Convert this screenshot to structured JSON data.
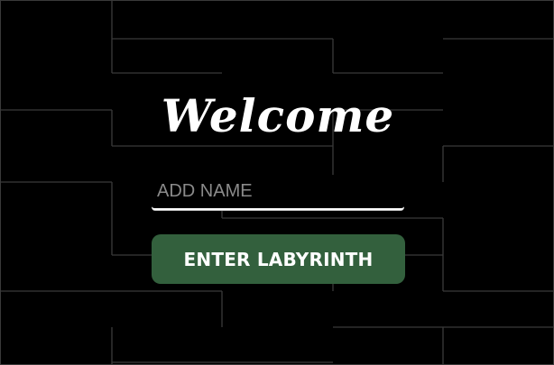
{
  "welcome": {
    "title": "Welcome"
  },
  "name_input": {
    "placeholder": "ADD NAME",
    "value": ""
  },
  "enter_button": {
    "label": "ENTER LABYRINTH"
  },
  "colors": {
    "background": "#000000",
    "maze_lines": "#3b3b3b",
    "button": "#33603d",
    "text": "#ffffff",
    "placeholder": "#8a8a8a"
  }
}
